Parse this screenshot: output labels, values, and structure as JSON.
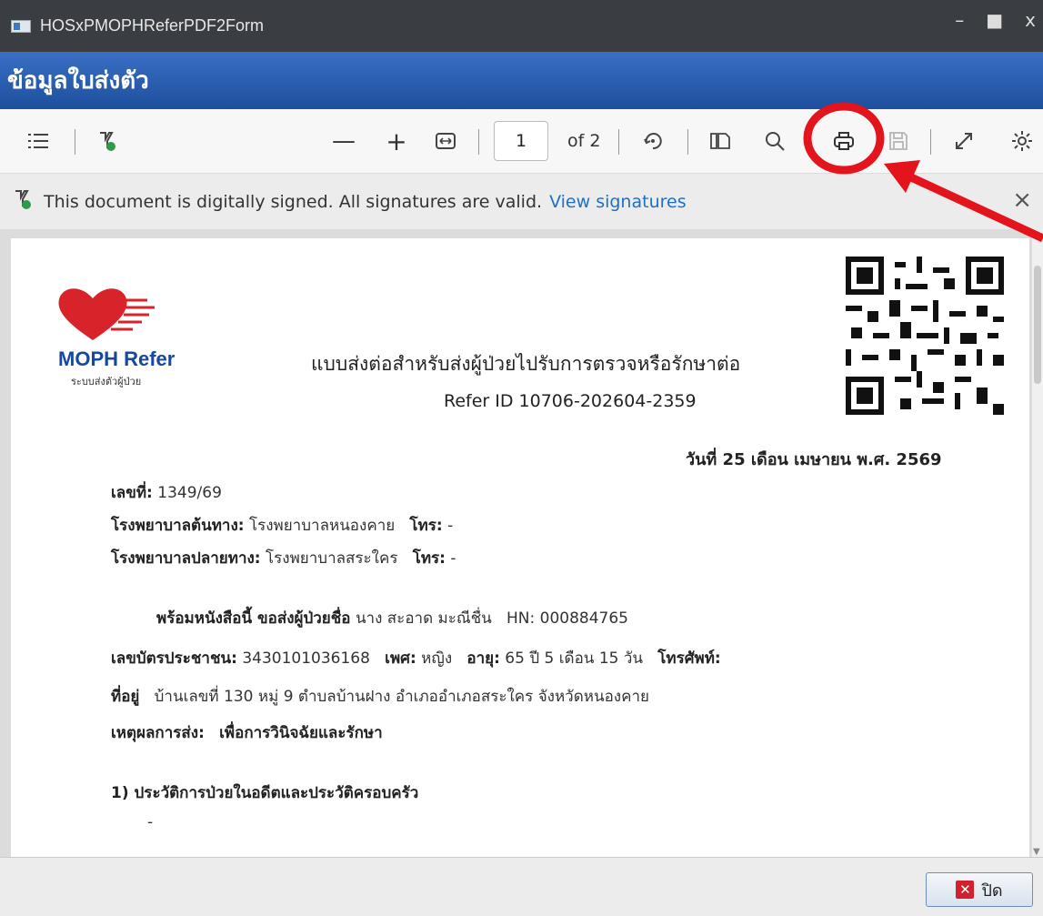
{
  "window": {
    "title": "HOSxPMOPHReferPDF2Form",
    "minimize": "–",
    "maximize": "■",
    "close": "x"
  },
  "header": {
    "title": "ข้อมูลใบส่งตัว"
  },
  "toolbar": {
    "zoom_out": "—",
    "zoom_in": "+",
    "page_number": "1",
    "of_pages": "of 2"
  },
  "signature_bar": {
    "message": "This document is digitally signed. All signatures are valid.",
    "link": "View signatures",
    "close": "×"
  },
  "document": {
    "logo_brand": "MOPH Refer",
    "logo_tagline": "ระบบส่งตัวผู้ป่วย",
    "title": "แบบส่งต่อสำหรับส่งผู้ป่วยไปรับการตรวจหรือรักษาต่อ",
    "refer_id": "Refer ID 10706-202604-2359",
    "date": "วันที่ 25 เดือน เมษายน พ.ศ. 2569",
    "no_label": "เลขที่:",
    "no_value": "1349/69",
    "origin_label": "โรงพยาบาลต้นทาง:",
    "origin_value": "โรงพยาบาลหนองคาย",
    "origin_phone_label": "โทร:",
    "origin_phone_value": "-",
    "dest_label": "โรงพยาบาลปลายทาง:",
    "dest_value": "โรงพยาบาลสระใคร",
    "dest_phone_label": "โทร:",
    "dest_phone_value": "-",
    "send_label": "พร้อมหนังสือนี้ ขอส่งผู้ป่วยชื่อ",
    "patient_name": "นาง สะอาด มะณีชื่น",
    "hn_label": "HN:",
    "hn_value": "000884765",
    "id_label": "เลขบัตรประชาชน:",
    "id_value": "3430101036168",
    "sex_label": "เพศ:",
    "sex_value": "หญิง",
    "age_label": "อายุ:",
    "age_value": "65 ปี 5 เดือน 15 วัน",
    "phone_label": "โทรศัพท์:",
    "address_label": "ที่อยู่",
    "address_value": "บ้านเลขที่ 130 หมู่ 9 ตำบลบ้านฝาง อำเภออำเภอสระใคร จังหวัดหนองคาย",
    "reason_label": "เหตุผลการส่ง:",
    "reason_value": "เพื่อการวินิจฉัยและรักษา",
    "section1": "1) ประวัติการป่วยในอดีตและประวัติครอบครัว",
    "section1_value": "-"
  },
  "footer": {
    "close_button": "ปิด"
  },
  "colors": {
    "title_bar": "#3a3d42",
    "header_blue": "#1d4f9c",
    "link_blue": "#1f6fc9",
    "annotation_red": "#e3141b",
    "brand_red": "#d8232a",
    "brand_blue": "#17479e"
  }
}
